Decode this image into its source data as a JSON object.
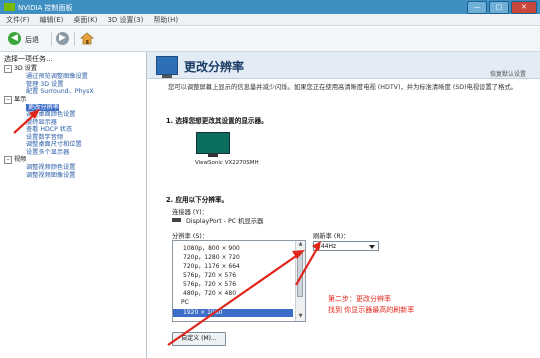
{
  "window": {
    "title": "NVIDIA 控制面板",
    "controls": [
      "—",
      "□",
      "✕"
    ]
  },
  "menu": [
    "文件(F)",
    "编辑(E)",
    "桌面(K)",
    "3D 设置(3)",
    "帮助(H)"
  ],
  "toolbar": {
    "back_label": "后退"
  },
  "sidebar": {
    "title": "选择一项任务...",
    "tree": [
      {
        "type": "node",
        "label": "3D 设置"
      },
      {
        "type": "leaf",
        "label": "通过预览调整图像设置"
      },
      {
        "type": "leaf",
        "label": "管理 3D 设置"
      },
      {
        "type": "leaf",
        "label": "配置 Surround、PhysX"
      },
      {
        "type": "node",
        "label": "显示"
      },
      {
        "type": "leaf",
        "label": "更改分辨率",
        "selected": true
      },
      {
        "type": "leaf",
        "label": "调整桌面颜色设置"
      },
      {
        "type": "leaf",
        "label": "旋转显示器"
      },
      {
        "type": "leaf",
        "label": "查看 HDCP 状态"
      },
      {
        "type": "leaf",
        "label": "设置数字音频"
      },
      {
        "type": "leaf",
        "label": "调整桌面尺寸和位置"
      },
      {
        "type": "leaf",
        "label": "设置多个显示器"
      },
      {
        "type": "node",
        "label": "视频"
      },
      {
        "type": "leaf",
        "label": "调整视频颜色设置"
      },
      {
        "type": "leaf",
        "label": "调整视频图像设置"
      }
    ]
  },
  "main": {
    "title": "更改分辨率",
    "restore_label": "恢复默认设置",
    "description": "您可以调整屏幕上显示的信息量并减少闪烁。如果您正在使用高清晰度电视 (HDTV)，并为标准清晰度 (SD)电视设置了格式。",
    "step1": "1.  选择您想更改其设置的显示器。",
    "monitor_label": "ViewSonic VX2270SMH",
    "step2": "2.  应用以下分辨率。",
    "connector_label": "连接器 (Y)：",
    "connector_value": "DisplayPort - PC 机显示器",
    "resolution_label": "分辨率 (S)：",
    "resolutions": [
      {
        "label": "1080p，800 × 900",
        "type": "item"
      },
      {
        "label": "720p，1280 × 720",
        "type": "item"
      },
      {
        "label": "720p，1176 × 664",
        "type": "item"
      },
      {
        "label": "576p，720 × 576",
        "type": "item"
      },
      {
        "label": "576p，720 × 576",
        "type": "item"
      },
      {
        "label": "480p，720 × 480",
        "type": "item"
      },
      {
        "label": "PC",
        "type": "category"
      },
      {
        "label": "1920 × 1080",
        "type": "selected"
      }
    ],
    "refresh_label": "刷新率 (R)：",
    "refresh_value": "144Hz",
    "customize_button": "自定义 (M)...",
    "annotation_line1": "第二步：更改分辨率",
    "annotation_line2": "找到 你显示器最高的刷新率"
  },
  "colors": {
    "accent": "#3d6ec7",
    "annotation": "#e0251b",
    "titlebar": "#3e8fc2"
  }
}
